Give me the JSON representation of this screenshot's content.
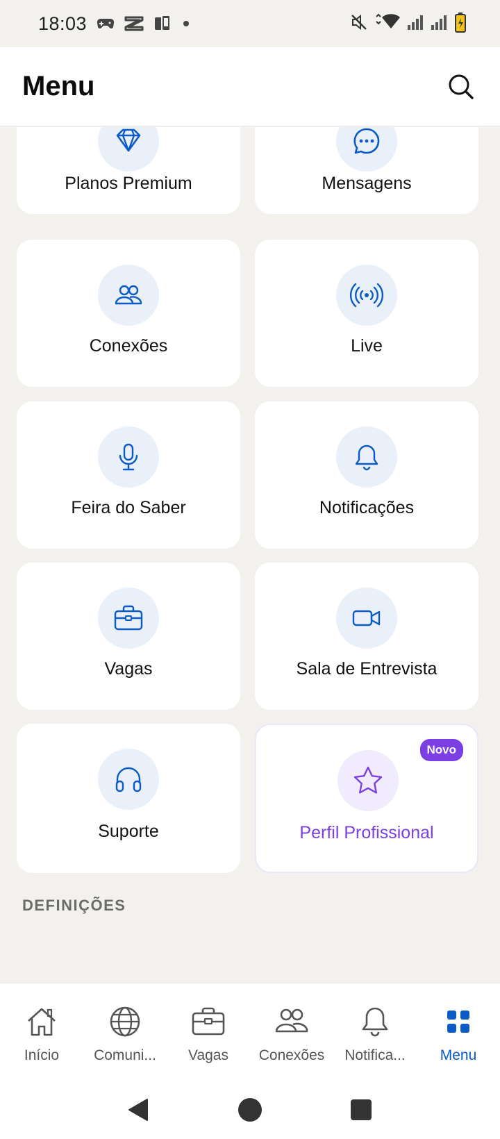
{
  "status_bar": {
    "time": "18:03"
  },
  "header": {
    "title": "Menu"
  },
  "cards": [
    {
      "label": "Planos Premium",
      "icon": "diamond-icon"
    },
    {
      "label": "Mensagens",
      "icon": "chat-bubble-icon"
    },
    {
      "label": "Conexões",
      "icon": "people-icon"
    },
    {
      "label": "Live",
      "icon": "broadcast-icon"
    },
    {
      "label": "Feira do Saber",
      "icon": "microphone-icon"
    },
    {
      "label": "Notificações",
      "icon": "bell-icon"
    },
    {
      "label": "Vagas",
      "icon": "briefcase-icon"
    },
    {
      "label": "Sala de Entrevista",
      "icon": "video-camera-icon"
    },
    {
      "label": "Suporte",
      "icon": "headphones-icon"
    },
    {
      "label": "Perfil Profissional",
      "icon": "star-icon",
      "badge": "Novo"
    }
  ],
  "section": {
    "title": "DEFINIÇÕES"
  },
  "bottom_nav": [
    {
      "label": "Início",
      "icon": "home-icon",
      "active": false
    },
    {
      "label": "Comuni...",
      "icon": "globe-icon",
      "active": false
    },
    {
      "label": "Vagas",
      "icon": "briefcase-icon",
      "active": false
    },
    {
      "label": "Conexões",
      "icon": "people-icon",
      "active": false
    },
    {
      "label": "Notifica...",
      "icon": "bell-icon",
      "active": false
    },
    {
      "label": "Menu",
      "icon": "grid-icon",
      "active": true
    }
  ],
  "colors": {
    "accent": "#0a5bc6",
    "featured": "#7b3fe4",
    "background": "#f2f1ee",
    "icon_bg": "#e9f0fa"
  }
}
